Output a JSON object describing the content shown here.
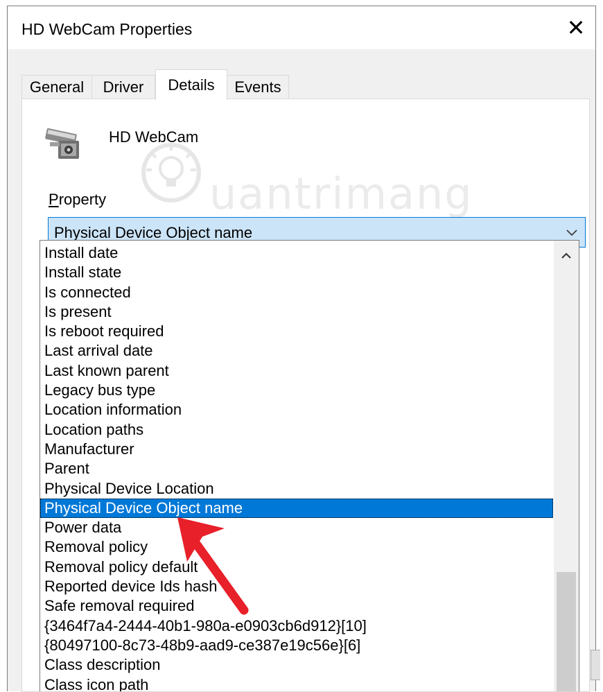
{
  "window": {
    "title": "HD WebCam Properties",
    "close_glyph": "✕"
  },
  "tabs": [
    {
      "label": "General",
      "active": false
    },
    {
      "label": "Driver",
      "active": false
    },
    {
      "label": "Details",
      "active": true
    },
    {
      "label": "Events",
      "active": false
    }
  ],
  "device": {
    "name": "HD WebCam",
    "icon": "webcam-device-icon"
  },
  "watermark": {
    "text": "uantrimang"
  },
  "property": {
    "label_accel": "P",
    "label_rest": "roperty",
    "selected_value": "Physical Device Object name"
  },
  "dropdown": {
    "items": [
      "Install date",
      "Install state",
      "Is connected",
      "Is present",
      "Is reboot required",
      "Last arrival date",
      "Last known parent",
      "Legacy bus type",
      "Location information",
      "Location paths",
      "Manufacturer",
      "Parent",
      "Physical Device Location",
      "Physical Device Object name",
      "Power data",
      "Removal policy",
      "Removal policy default",
      "Reported device Ids hash",
      "Safe removal required",
      "{3464f7a4-2444-40b1-980a-e0903cb6d912}[10]",
      "{80497100-8c73-48b9-aad9-ce387e19c56e}[6]",
      "Class description",
      "Class icon path"
    ],
    "selected_index": 13
  },
  "colors": {
    "selection": "#0078d7",
    "combo_bg": "#cce4f7",
    "annotation_arrow": "#e8202a"
  }
}
